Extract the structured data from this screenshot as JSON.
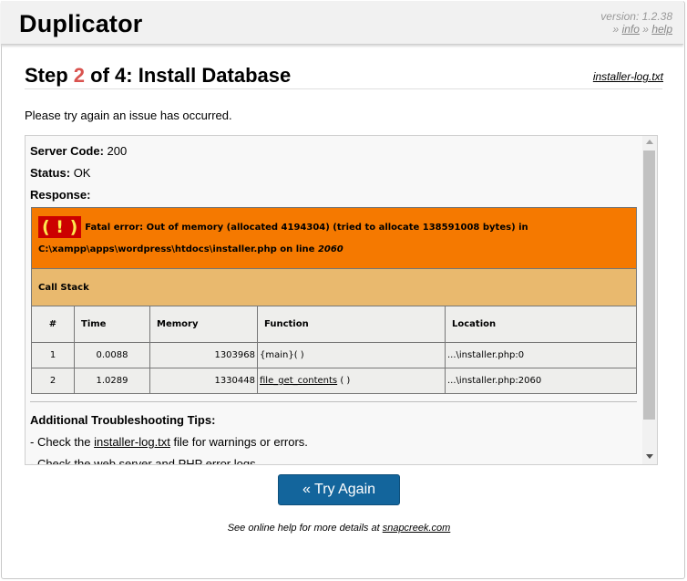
{
  "header": {
    "logo": "Duplicator",
    "version": "version: 1.2.38",
    "sep1": "»",
    "info_link": "info",
    "sep2": "»",
    "help_link": "help"
  },
  "step": {
    "prefix": "Step ",
    "number": "2",
    "suffix": " of 4: Install Database",
    "log_link": "installer-log.txt"
  },
  "message": "Please try again an issue has occurred.",
  "result": {
    "server_code_label": "Server Code:",
    "server_code_value": "200",
    "status_label": "Status:",
    "status_value": "OK",
    "response_label": "Response:",
    "error_icon": "( ! )",
    "error_text": "Fatal error: Out of memory (allocated 4194304) (tried to allocate 138591008 bytes) in C:\\xampp\\apps\\wordpress\\htdocs\\installer.php on line ",
    "error_line": "2060",
    "call_stack_label": "Call Stack",
    "columns": [
      "#",
      "Time",
      "Memory",
      "Function",
      "Location"
    ],
    "rows": [
      {
        "n": "1",
        "time": "0.0088",
        "memory": "1303968",
        "func": "{main}( )",
        "location": "...\\installer.php:0"
      },
      {
        "n": "2",
        "time": "1.0289",
        "memory": "1330448",
        "func_link": "file_get_contents",
        "func_suffix": " ( )",
        "location": "...\\installer.php:2060"
      }
    ],
    "tips_title": "Additional Troubleshooting Tips:",
    "tip1_prefix": "- Check the ",
    "tip1_link": "installer-log.txt",
    "tip1_suffix": " file for warnings or errors.",
    "tip2": "- Check the web server and PHP error logs."
  },
  "try_again_label": "« Try Again",
  "footer": {
    "prefix": "See online help for more details at ",
    "link": "snapcreek.com"
  }
}
